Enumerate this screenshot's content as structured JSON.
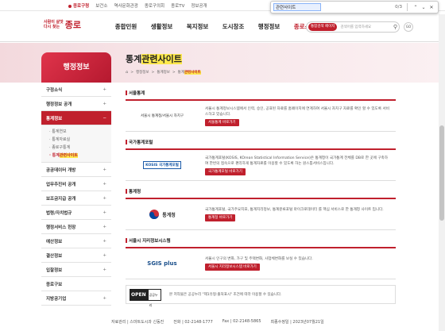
{
  "topbar": {
    "links": [
      "홈페이지",
      "보건소",
      "역사문화관광",
      "종로구의회",
      "종로TV",
      "정보공개"
    ],
    "active_index": 0,
    "first_label": "종로구청"
  },
  "find": {
    "term": "관련사이트",
    "count": "0/3"
  },
  "header": {
    "logo_line1": "사람이 살맛",
    "logo_line2": "다시 찾는",
    "logo_big": "종로",
    "nav": [
      "종합민원",
      "생활정보",
      "복지정보",
      "도시창조",
      "행정정보",
      "종로소개"
    ],
    "search_select": "통합검색 페이지",
    "search_placeholder": "검색어를 입력하세요",
    "go_label": "GO"
  },
  "sidebar": {
    "title": "행정정보",
    "items": [
      {
        "label": "구정소식",
        "expand": "+"
      },
      {
        "label": "행정정보 공개",
        "expand": "+"
      },
      {
        "label": "통계정보",
        "expand": "−"
      }
    ],
    "subitems": [
      "통계연보",
      "통계자료실",
      "종로구통계",
      "통계관련사이트"
    ],
    "subitem_current_prefix": "통계",
    "subitem_current_mark": "관련사이트",
    "items_after": [
      {
        "label": "공공데이터 개방",
        "expand": "+"
      },
      {
        "label": "업무추진비 공개",
        "expand": "+"
      },
      {
        "label": "보조금지급 공개",
        "expand": "+"
      },
      {
        "label": "법령/자치법규",
        "expand": "+"
      },
      {
        "label": "행정서비스 헌장",
        "expand": "+"
      },
      {
        "label": "예산정보",
        "expand": "+"
      },
      {
        "label": "결산정보",
        "expand": "+"
      },
      {
        "label": "입찰정보",
        "expand": "+"
      },
      {
        "label": "종로구보",
        "expand": ""
      },
      {
        "label": "지방공기업",
        "expand": "+"
      }
    ]
  },
  "page": {
    "title_prefix": "통계",
    "title_mark": "관련사이트",
    "breadcrumb": [
      "행정정보",
      "통계정보"
    ],
    "breadcrumb_last_prefix": "통계",
    "breadcrumb_last_mark": "관련사이트"
  },
  "sections": [
    {
      "title": "서울통계",
      "logo": "서울시 통계청/서울시 자치구",
      "text": "서울시 통계정보시스템에서 인력, 승인, 공표된 자료를 홈페이지에 연계하여 서울시 자치구 자료를 확인 할 수 있도록 서비스하고 있습니다.",
      "button": "서울통계 바로가기"
    },
    {
      "title": "국가통계포털",
      "logo": "KOSIS 국가통계포털",
      "text": "국가통계포털(KOSIS, KOrean Statistical Information Service)은 통계청이 국가통계 전체를 DB로 한 곳에 구축하여 한번의 접속으로 편리하게 통계자료를 이용할 수 있도록 하는 원스톱서비스입니다.",
      "button": "국가통계포털 바로가기"
    },
    {
      "title": "통계청",
      "logo": "통계청",
      "text": "국가통계포털, 국가주요지표, 통계지리정보, 통계분류포털 마이크로데이터 를 핵심 서비스로 한 통계청 사이트 입니다.",
      "button": "통계청 바로가기"
    },
    {
      "title": "서울시 지리정보시스템",
      "logo": "SGIS plus",
      "text": "서울시 인구의 변화, 가구 및 주택변화, 사업체변화를 보실 수 있습니다.",
      "button": "서울시 지리정보시스템 바로가기"
    }
  ],
  "open_notice": {
    "logo_open": "OPEN",
    "logo_sub": "공공누리",
    "text": "본 저작물은 공공누리 \"제1유형:출처표시\" 조건에 따라 이용할 수 있습니다."
  },
  "footer": {
    "dept_label": "자료관리",
    "dept": "스마트도시과 신동진",
    "tel_label": "전화",
    "tel": "02-2148-1777",
    "fax_label": "Fax",
    "fax": "02-2148-5865",
    "updated_label": "최종수정일",
    "updated": "2023년07월21일"
  }
}
